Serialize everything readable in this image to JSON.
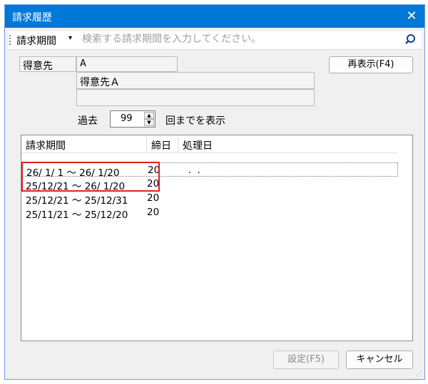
{
  "window": {
    "title": "請求履歴",
    "close_glyph": "✕"
  },
  "search": {
    "label": "請求期間",
    "caret": "▾",
    "placeholder": "検索する請求期間を入力してください。"
  },
  "customer": {
    "label": "得意先",
    "code": "A",
    "name": "得意先Ａ",
    "extra": ""
  },
  "refresh_button": "再表示(F4)",
  "past": {
    "prefix": "過去",
    "count": "99",
    "suffix": "回までを表示"
  },
  "grid": {
    "headers": [
      "請求期間",
      "締日",
      "処理日"
    ],
    "rows": [
      {
        "period": "26/ 1/ 1 ～ 26/ 1/20",
        "close": "20",
        "processed": "  .  ."
      },
      {
        "period": "25/12/21 ～ 26/ 1/20",
        "close": "20",
        "processed": ""
      },
      {
        "period": "25/12/21 ～ 25/12/31",
        "close": "20",
        "processed": ""
      },
      {
        "period": "25/11/21 ～ 25/12/20",
        "close": "20",
        "processed": ""
      }
    ]
  },
  "buttons": {
    "set": "設定(F5)",
    "cancel": "キャンセル"
  },
  "colors": {
    "titlebar": "#0078d7",
    "highlight_box": "#e02020"
  },
  "icons": {
    "search": "search-icon",
    "close": "close-icon"
  }
}
